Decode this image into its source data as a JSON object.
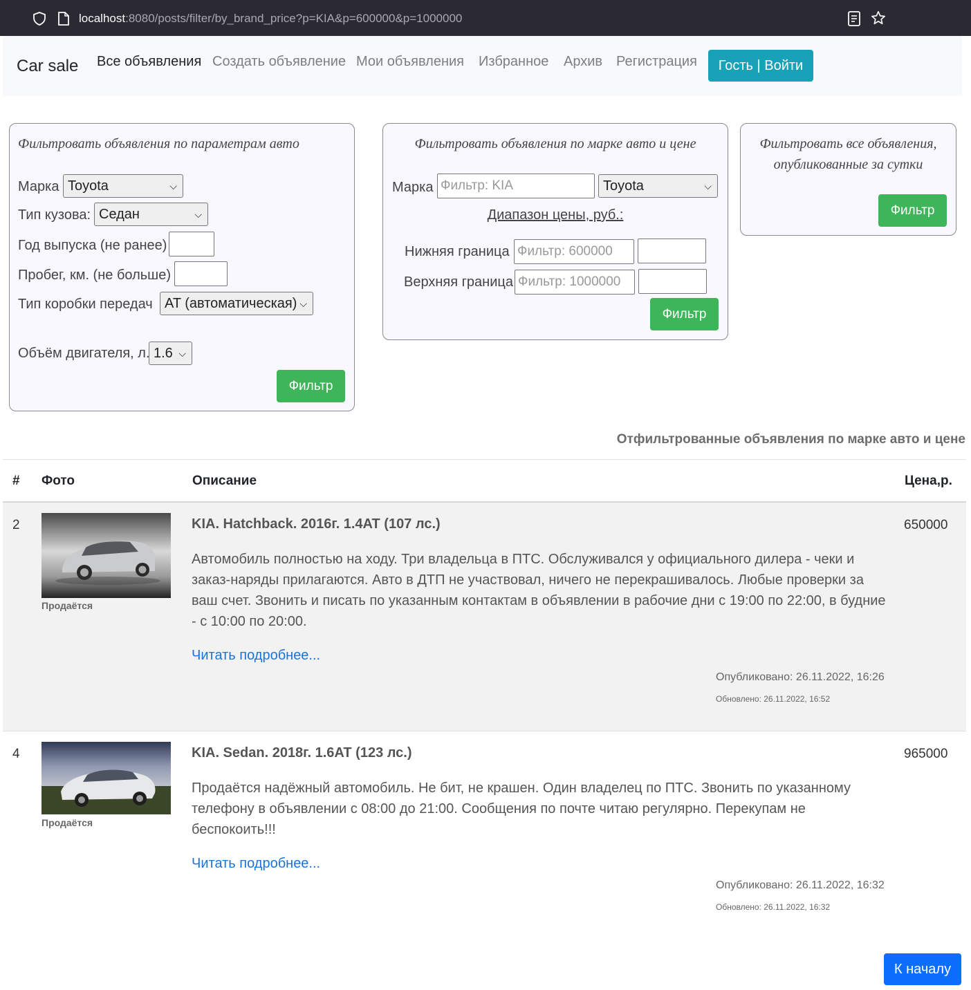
{
  "browser": {
    "url_host": "localhost",
    "url_rest": ":8080/posts/filter/by_brand_price?p=KIA&p=600000&p=1000000"
  },
  "navbar": {
    "brand": "Car sale",
    "links": [
      "Все объявления",
      "Создать объявление",
      "Мои объявления",
      "Избранное",
      "Архив",
      "Регистрация"
    ],
    "login": "Гость | Войти"
  },
  "filter_params": {
    "title": "Фильтровать объявления по параметрам авто",
    "brand_label": "Марка",
    "brand_value": "Toyota",
    "body_label": "Тип кузова:",
    "body_value": "Седан",
    "year_label": "Год выпуска (не ранее)",
    "year_value": "",
    "mileage_label": "Пробег, км. (не больше)",
    "mileage_value": "",
    "gearbox_label": "Тип коробки передач",
    "gearbox_value": "AT (автоматическая)",
    "engine_label": "Объём двигателя, л.",
    "engine_value": "1.6",
    "button": "Фильтр"
  },
  "filter_brand_price": {
    "title": "Фильтровать объявления по марке авто и цене",
    "brand_label": "Марка",
    "brand_placeholder": "Фильтр: KIA",
    "brand_value": "Toyota",
    "range_label": "Диапазон цены, руб.:",
    "lower_label": "Нижняя граница",
    "lower_placeholder": "Фильтр: 600000",
    "lower_value": "",
    "upper_label": "Верхняя граница",
    "upper_placeholder": "Фильтр: 1000000",
    "upper_value": "",
    "button": "Фильтр"
  },
  "filter_day": {
    "title_line1": "Фильтровать все объявления,",
    "title_line2": "опубликованные за сутки",
    "button": "Фильтр"
  },
  "results": {
    "heading": "Отфильтрованные объявления по марке авто и цене",
    "columns": [
      "#",
      "Фото",
      "Описание",
      "Цена,р."
    ],
    "rows": [
      {
        "num": "2",
        "status": "Продаётся",
        "title": "KIA. Hatchback. 2016г. 1.4AT (107 лс.)",
        "description": "Автомобиль полностью на ходу. Три владельца в ПТС. Обслуживался у официального дилера - чеки и заказ-наряды прилагаются. Авто в ДТП не участвовал, ничего не перекрашивалось. Любые проверки за ваш счет. Звонить и писать по указанным контактам в объявлении в рабочие дни с 19:00 по 22:00, в будние - с 10:00 по 20:00.",
        "more": "Читать подробнее...",
        "published": "Опубликовано: 26.11.2022, 16:26",
        "updated": "Обновлено: 26.11.2022, 16:52",
        "price": "650000"
      },
      {
        "num": "4",
        "status": "Продаётся",
        "title": "KIA. Sedan. 2018г. 1.6AT (123 лс.)",
        "description": "Продаётся надёжный автомобиль. Не бит, не крашен. Один владелец по ПТС. Звонить по указанному телефону в объявлении с 08:00 до 21:00. Сообщения по почте читаю регулярно. Перекупам не беспокоить!!!",
        "more": "Читать подробнее...",
        "published": "Опубликовано: 26.11.2022, 16:32",
        "updated": "Обновлено: 26.11.2022, 16:32",
        "price": "965000"
      }
    ]
  },
  "back_to_top": "К началу",
  "icons": [
    "shield-icon",
    "page-icon",
    "reader-view-icon",
    "bookmark-star-icon",
    "chevron-down-icon"
  ],
  "colors": {
    "browser_bar": "#2b2a33",
    "login_button": "#17a2b8",
    "filter_button": "#3fb55a",
    "top_button": "#0d6efd",
    "link": "#1a73d9"
  }
}
